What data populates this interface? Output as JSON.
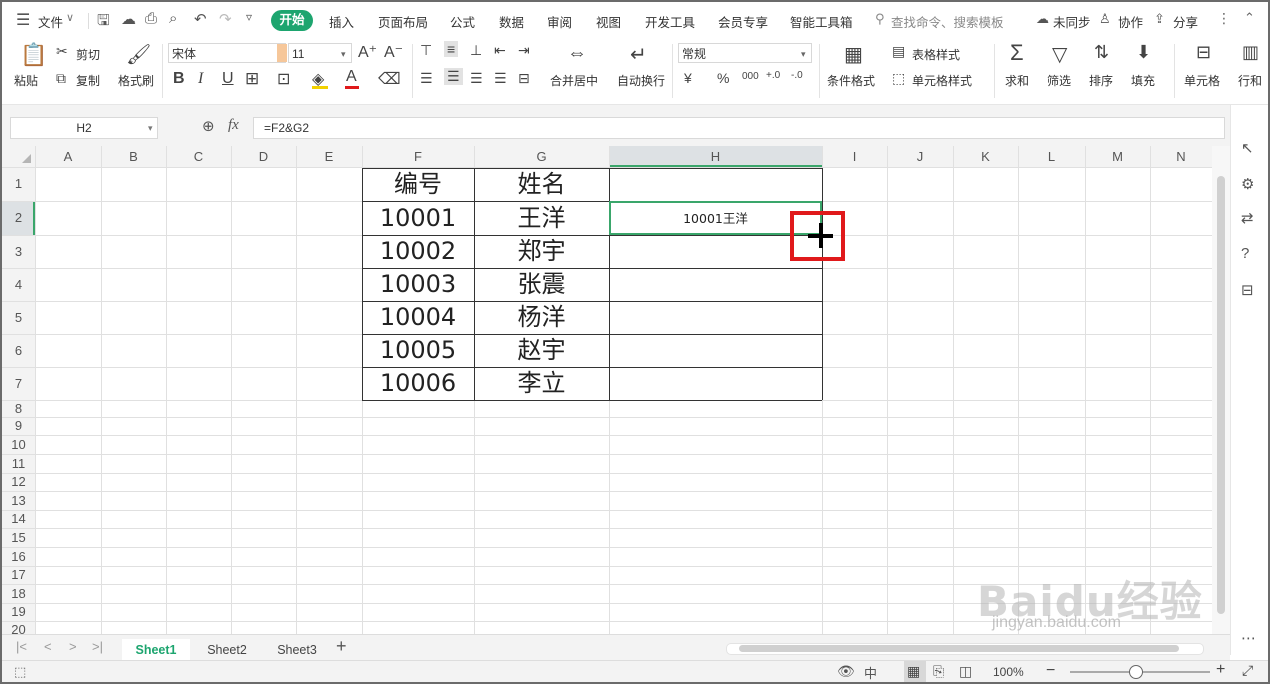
{
  "menu": {
    "file": "文件",
    "tabs": [
      "开始",
      "插入",
      "页面布局",
      "公式",
      "数据",
      "审阅",
      "视图",
      "开发工具",
      "会员专享",
      "智能工具箱"
    ],
    "search": "查找命令、搜索模板",
    "sync": "未同步",
    "collab": "协作",
    "share": "分享"
  },
  "ribbon": {
    "cut": "剪切",
    "paste": "粘贴",
    "copy": "复制",
    "format_painter": "格式刷",
    "font_name": "宋体",
    "font_size": "11",
    "bold": "B",
    "italic": "I",
    "underline": "U",
    "merge_center": "合并居中",
    "wrap_text": "自动换行",
    "number_format": "常规",
    "currency": "¥",
    "percent": "%",
    "thousands": "000",
    "inc_decimal": "+.0",
    "dec_decimal": "-.0",
    "cond_format": "条件格式",
    "table_style": "表格样式",
    "cell_style": "单元格样式",
    "sum": "求和",
    "filter": "筛选",
    "sort": "排序",
    "fill": "填充",
    "cells": "单元格",
    "rows_cols": "行和"
  },
  "formula_bar": {
    "name_box": "H2",
    "fx": "fx",
    "formula": "=F2&G2"
  },
  "sheet": {
    "columns": [
      "A",
      "B",
      "C",
      "D",
      "E",
      "F",
      "G",
      "H",
      "I",
      "J",
      "K",
      "L",
      "M",
      "N"
    ],
    "rows": [
      "1",
      "2",
      "3",
      "4",
      "5",
      "6",
      "7",
      "8",
      "9",
      "10",
      "11",
      "12",
      "13",
      "14",
      "15",
      "16",
      "17",
      "18",
      "19",
      "20"
    ],
    "table": {
      "header": [
        "编号",
        "姓名",
        ""
      ],
      "data": [
        [
          "10001",
          "王洋",
          "10001王洋"
        ],
        [
          "10002",
          "郑宇",
          ""
        ],
        [
          "10003",
          "张震",
          ""
        ],
        [
          "10004",
          "杨洋",
          ""
        ],
        [
          "10005",
          "赵宇",
          ""
        ],
        [
          "10006",
          "李立",
          ""
        ]
      ]
    },
    "selected_cell": "H2"
  },
  "sheet_tabs": [
    "Sheet1",
    "Sheet2",
    "Sheet3"
  ],
  "active_sheet": "Sheet1",
  "status": {
    "zoom": "100%"
  },
  "watermark": {
    "brand": "Baidu经验",
    "url": "jingyan.baidu.com"
  },
  "colors": {
    "accent_green": "#1da56f",
    "selection_green": "#3aa66b",
    "highlight_red": "#e0191b"
  }
}
